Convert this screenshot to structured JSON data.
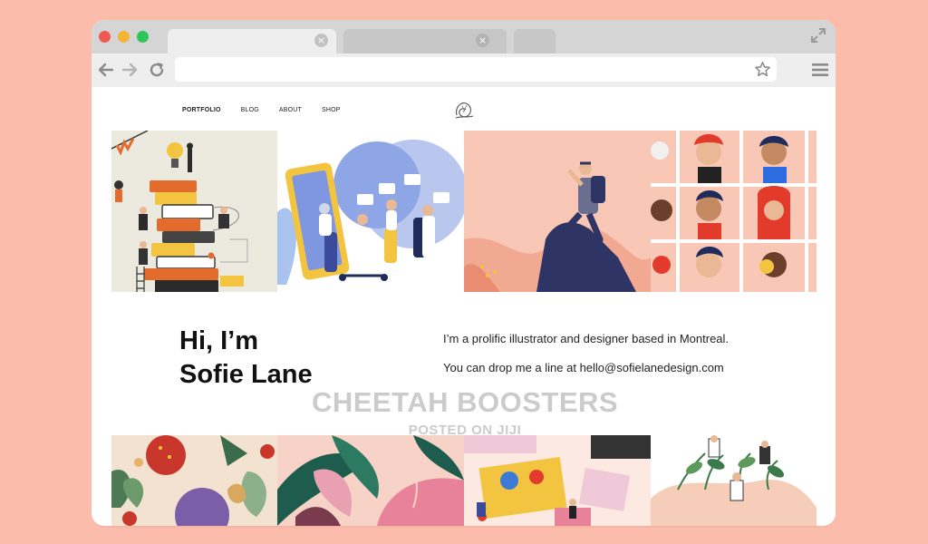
{
  "browser": {
    "colors": {
      "background": "#fbbcac",
      "chrome": "#d5d5d5",
      "toolbar": "#eeeeee"
    }
  },
  "site": {
    "nav": {
      "portfolio": "PORTFOLIO",
      "blog": "BLOG",
      "about": "ABOUT",
      "shop": "SHOP"
    },
    "hero": {
      "title_line1": "Hi, I’m",
      "title_line2": "Sofie Lane",
      "intro": "I’m a prolific illustrator and designer based in Montreal.",
      "contact": "You can drop me a line at hello@sofielanedesign.com"
    }
  },
  "watermark": {
    "brand": "CHEETAH BOOSTERS",
    "posted": "POSTED ON JIJI"
  }
}
